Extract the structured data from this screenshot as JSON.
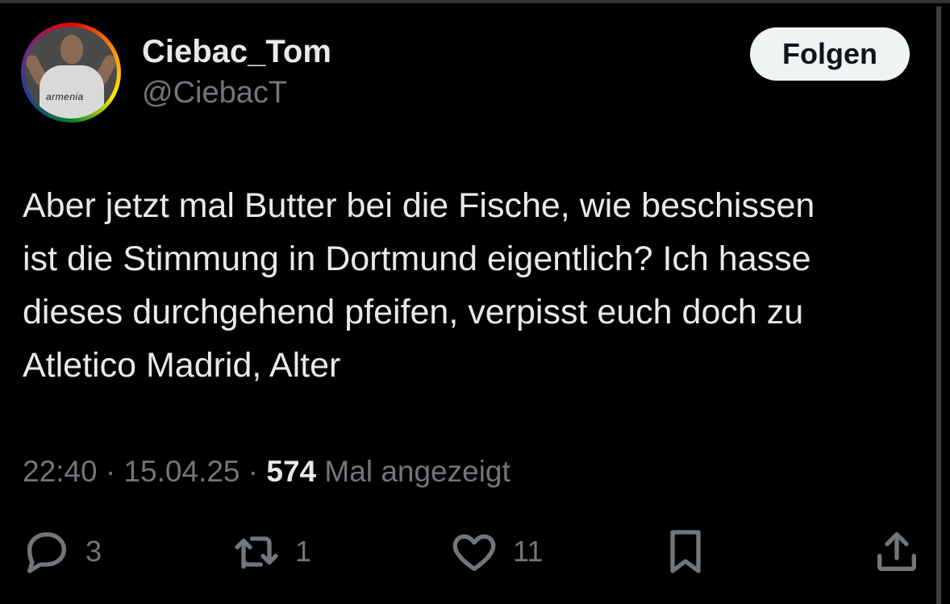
{
  "user": {
    "display_name": "Ciebac_Tom",
    "handle": "@CiebacT",
    "avatar_sponsor_text": "armenia"
  },
  "follow_button": {
    "label": "Folgen"
  },
  "tweet": {
    "text": "Aber jetzt mal Butter bei die Fische, wie beschissen\nist die Stimmung in Dortmund eigentlich? Ich hasse\ndieses durchgehend pfeifen, verpisst euch doch zu\nAtletico Madrid, Alter",
    "time": "22:40",
    "separator": " · ",
    "date": "15.04.25",
    "views_count": "574",
    "views_label": " Mal angezeigt"
  },
  "actions": {
    "reply": {
      "icon": "reply-icon",
      "count": "3"
    },
    "retweet": {
      "icon": "retweet-icon",
      "count": "1"
    },
    "like": {
      "icon": "heart-icon",
      "count": "11"
    },
    "bookmark": {
      "icon": "bookmark-icon"
    },
    "share": {
      "icon": "share-icon"
    }
  },
  "colors": {
    "background": "#000000",
    "primary_text": "#e7e9ea",
    "secondary_text": "#71767b",
    "button_bg": "#eff3f4",
    "button_text": "#0f1419"
  }
}
